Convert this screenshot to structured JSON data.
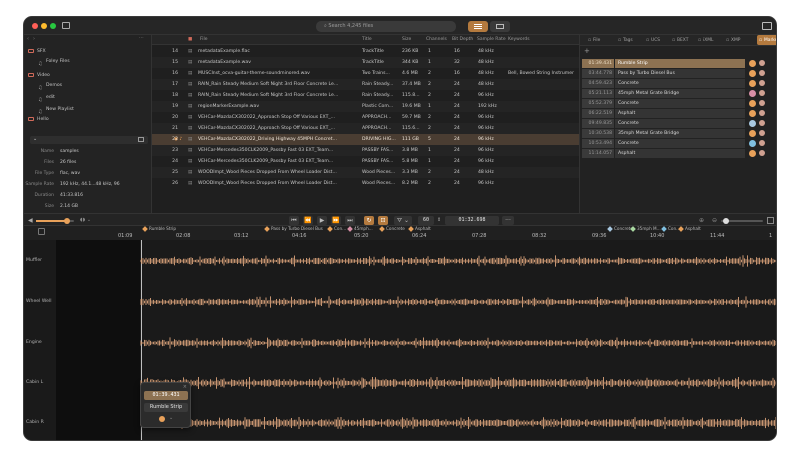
{
  "search": {
    "placeholder": "Search 4,245 files"
  },
  "sidebar": {
    "items": [
      {
        "label": "SFX",
        "indent": 0
      },
      {
        "label": "Foley Files",
        "indent": 1
      },
      {
        "label": "Video",
        "indent": 0
      },
      {
        "label": "Demos",
        "indent": 1
      },
      {
        "label": "edit",
        "indent": 1
      },
      {
        "label": "New Playlist",
        "indent": 1
      },
      {
        "label": "Hello",
        "indent": 0
      }
    ],
    "props": [
      {
        "k": "Name",
        "v": "samples"
      },
      {
        "k": "Files",
        "v": "26 files"
      },
      {
        "k": "File Type",
        "v": "flac, wav"
      },
      {
        "k": "Sample Rate",
        "v": "192 kHz, 44.1...48 kHz, 96"
      },
      {
        "k": "Duration",
        "v": "41:33.816"
      },
      {
        "k": "Size",
        "v": "2.14 GB"
      }
    ]
  },
  "table": {
    "headers": [
      "File",
      "Title",
      "Size",
      "Channels",
      "Bit Depth",
      "Sample Rate",
      "Keywords"
    ],
    "rows": [
      {
        "n": "14",
        "file": "metadataExample.flac",
        "title": "TrackTitle",
        "size": "236 KB",
        "ch": "1",
        "bit": "16",
        "sr": "48 kHz",
        "kw": ""
      },
      {
        "n": "15",
        "file": "metadataExample.wav",
        "title": "TrackTitle",
        "size": "344 KB",
        "ch": "1",
        "bit": "32",
        "sr": "48 kHz",
        "kw": ""
      },
      {
        "n": "16",
        "file": "MUSCInst_ocva-guitar-theme-soundminored.wav",
        "title": "Two Trains...",
        "size": "4.6 MB",
        "ch": "2",
        "bit": "16",
        "sr": "48 kHz",
        "kw": "Bell, Bowed String Instrumer"
      },
      {
        "n": "17",
        "file": "RAIN_Rain Steady Medium Soft Night 3rd Floor Concrete Le...",
        "title": "Rain Steady...",
        "size": "37.4 MB",
        "ch": "2",
        "bit": "24",
        "sr": "48 kHz",
        "kw": ""
      },
      {
        "n": "18",
        "file": "RAIN_Rain Steady Medium Soft Night 3rd Floor Concrete Le...",
        "title": "Rain Steady...",
        "size": "115.8...",
        "ch": "2",
        "bit": "24",
        "sr": "96 kHz",
        "kw": ""
      },
      {
        "n": "19",
        "file": "regionMarkerExample.wav",
        "title": "Plastic Com...",
        "size": "19.6 MB",
        "ch": "1",
        "bit": "24",
        "sr": "192 kHz",
        "kw": ""
      },
      {
        "n": "20",
        "file": "VEHCar-MazdaCX302022_Approach Stop Off Various EXT_...",
        "title": "APPROACH...",
        "size": "59.7 MB",
        "ch": "2",
        "bit": "24",
        "sr": "96 kHz",
        "kw": ""
      },
      {
        "n": "21",
        "file": "VEHCar-MazdaCX302022_Approach Stop Off Various EXT_...",
        "title": "APPROACH...",
        "size": "115.6...",
        "ch": "2",
        "bit": "24",
        "sr": "96 kHz",
        "kw": ""
      },
      {
        "n": "22",
        "file": "VEHCar-MazdaCX302022_Driving Highway 45MPH Concret...",
        "title": "DRIVING HIG...",
        "size": "111 GB",
        "ch": "5",
        "bit": "24",
        "sr": "96 kHz",
        "kw": "",
        "sel": true
      },
      {
        "n": "23",
        "file": "VEHCar-Mercedes350CLK2009_Passby Fast 03 EXT_Team...",
        "title": "PASSBY FAS...",
        "size": "3.8 MB",
        "ch": "1",
        "bit": "24",
        "sr": "96 kHz",
        "kw": ""
      },
      {
        "n": "24",
        "file": "VEHCar-Mercedes350CLK2009_Passby Fast 03 EXT_Team...",
        "title": "PASSBY FAS...",
        "size": "5.8 MB",
        "ch": "1",
        "bit": "24",
        "sr": "96 kHz",
        "kw": ""
      },
      {
        "n": "25",
        "file": "WOODImpt_Wood Pieces Dropped From Wheel Loader Dist...",
        "title": "Wood Pieces...",
        "size": "3.3 MB",
        "ch": "2",
        "bit": "24",
        "sr": "48 kHz",
        "kw": ""
      },
      {
        "n": "26",
        "file": "WOODImpt_Wood Pieces Dropped From Wheel Loader Dist...",
        "title": "Wood Pieces...",
        "size": "8.2 MB",
        "ch": "2",
        "bit": "24",
        "sr": "96 kHz",
        "kw": ""
      }
    ]
  },
  "right_tabs": [
    "File",
    "Tags",
    "UCS",
    "BEXT",
    "iXML",
    "XMP",
    "Markers"
  ],
  "markers": [
    {
      "t": "01:39.431",
      "name": "Rumble Strip",
      "color": "#e8a15a",
      "sel": true
    },
    {
      "t": "03:44.778",
      "name": "Pass by Turbo Diesel Bus",
      "color": "#e8a15a"
    },
    {
      "t": "04:59.423",
      "name": "Concrete",
      "color": "#e8a15a"
    },
    {
      "t": "05:21.113",
      "name": "45mph Metal Grate Bridge",
      "color": "#d88fa6"
    },
    {
      "t": "05:52.379",
      "name": "Concrete",
      "color": "#e8a15a"
    },
    {
      "t": "06:22.519",
      "name": "Asphalt",
      "color": "#e8a15a"
    },
    {
      "t": "09:49.835",
      "name": "Concrete",
      "color": "#a8c8e0"
    },
    {
      "t": "10:30.538",
      "name": "35mph Metal Grate Bridge",
      "color": "#e8a15a"
    },
    {
      "t": "10:53.494",
      "name": "Concrete",
      "color": "#7fbfe0"
    },
    {
      "t": "11:14.057",
      "name": "Asphalt",
      "color": "#e8a15a"
    }
  ],
  "transport": {
    "loop_count": "60",
    "position": "01:32.698"
  },
  "ruler": {
    "ticks": [
      "01:09",
      "02:08",
      "03:12",
      "04:16",
      "05:20",
      "06:24",
      "07:28",
      "08:32",
      "09:36",
      "10:40",
      "11:44",
      "1"
    ],
    "flags": [
      {
        "label": "Rumble Strip",
        "color": "#e8a15a"
      },
      {
        "label": "Pass by Turbo Diesel Bus",
        "color": "#e8a15a"
      },
      {
        "label": "Con...",
        "color": "#e8a15a"
      },
      {
        "label": "45mph...",
        "color": "#d88fa6"
      },
      {
        "label": "Concrete",
        "color": "#e8a15a"
      },
      {
        "label": "Asphalt",
        "color": "#e8a15a"
      },
      {
        "label": "Concrete",
        "color": "#a8c8e0"
      },
      {
        "label": "35mph M...",
        "color": "#a8d8a0"
      },
      {
        "label": "Con...",
        "color": "#7fbfe0"
      },
      {
        "label": "Asphalt",
        "color": "#e8a15a"
      }
    ]
  },
  "tracks": [
    "Muffler",
    "Wheel Well",
    "Engine",
    "Cabin L",
    "Cabin R"
  ],
  "popup": {
    "time": "01:39.431",
    "name": "Rumble Strip"
  },
  "colors": {
    "accent": "#e8a15a",
    "selected_row": "#4a3d32"
  }
}
